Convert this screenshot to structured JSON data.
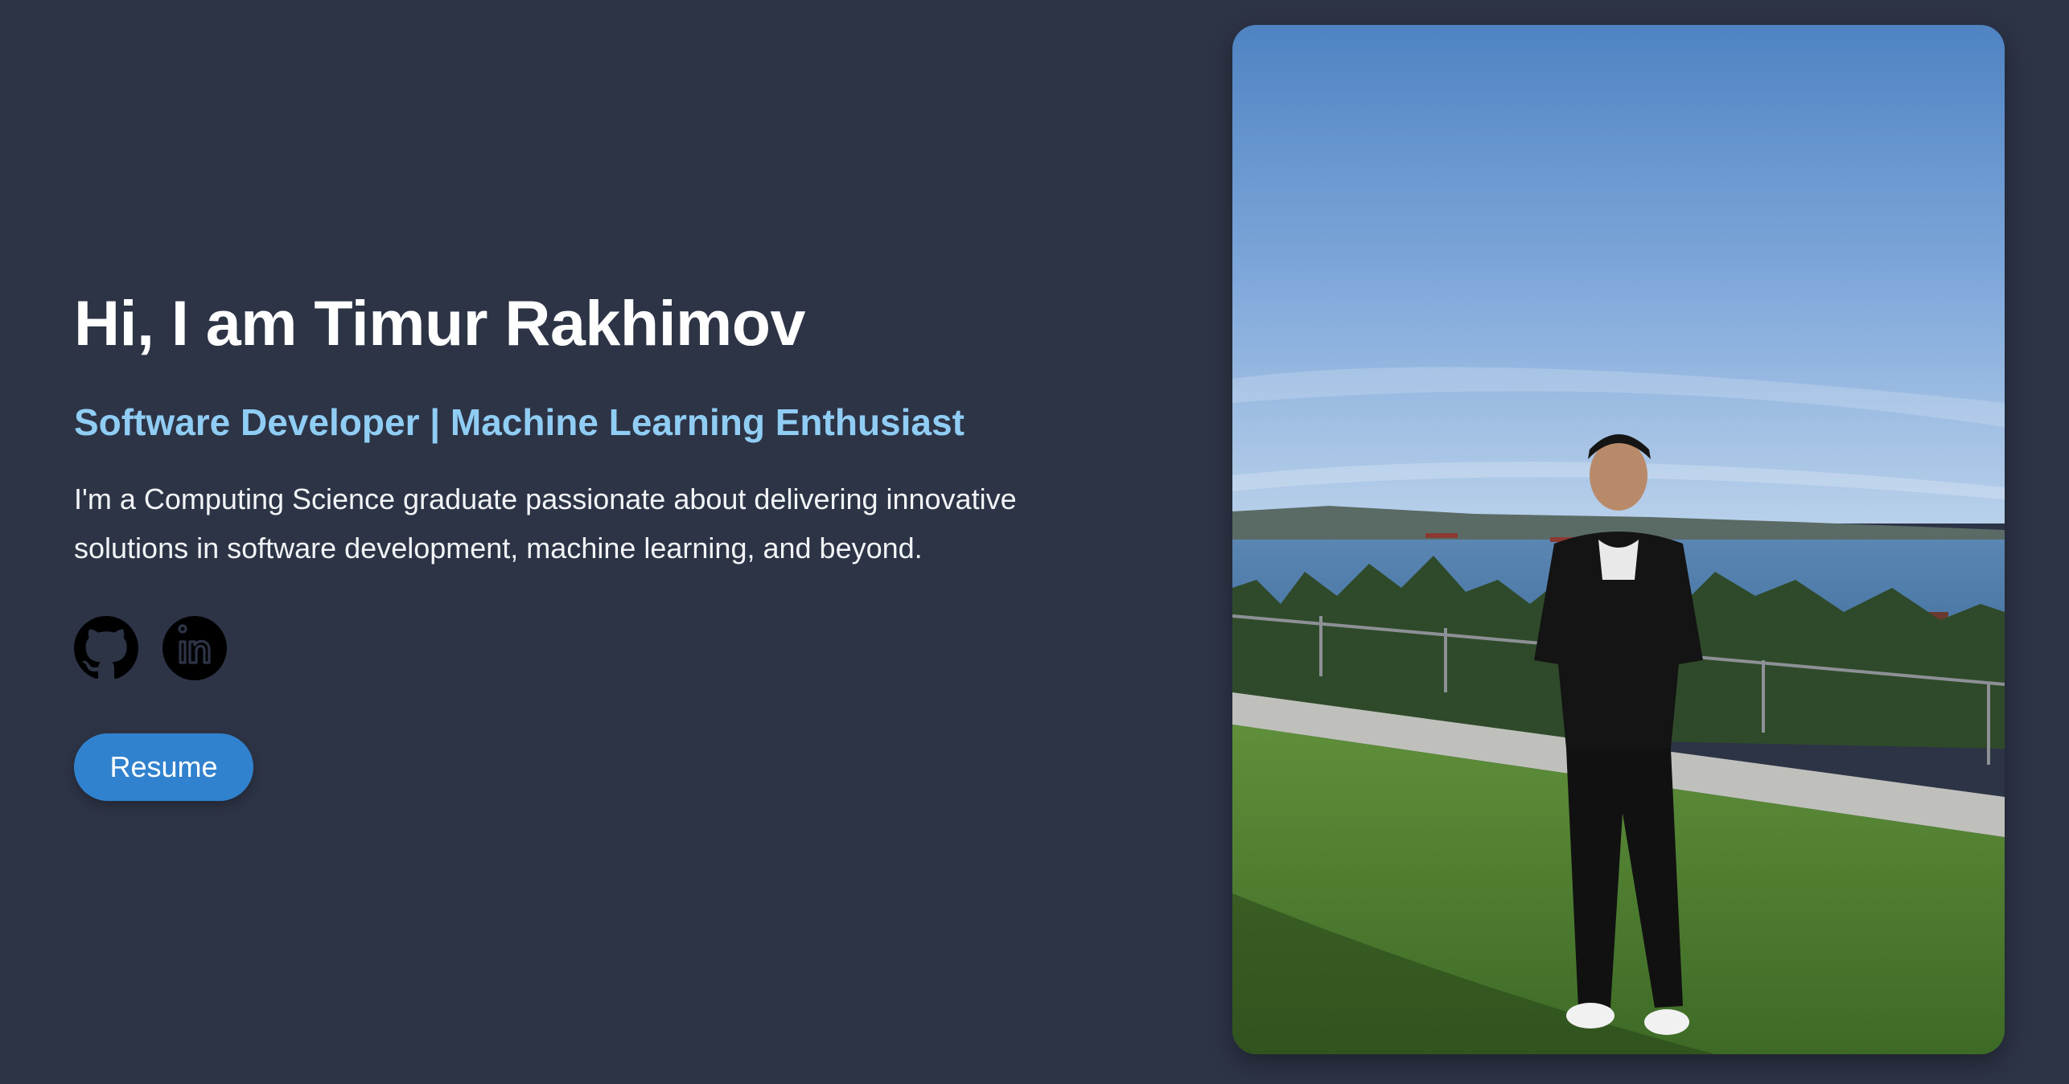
{
  "hero": {
    "headline": "Hi, I am Timur Rakhimov",
    "subtitle": "Software Developer | Machine Learning Enthusiast",
    "intro": "I'm a Computing Science graduate passionate about delivering innovative solutions in software development, machine learning, and beyond.",
    "resume_label": "Resume"
  },
  "socials": [
    {
      "name": "GitHub",
      "icon": "github-icon"
    },
    {
      "name": "LinkedIn",
      "icon": "linkedin-icon"
    }
  ],
  "colors": {
    "background": "#2d3446",
    "headline": "#ffffff",
    "subtitle": "#90cdf4",
    "button": "#3182ce"
  }
}
